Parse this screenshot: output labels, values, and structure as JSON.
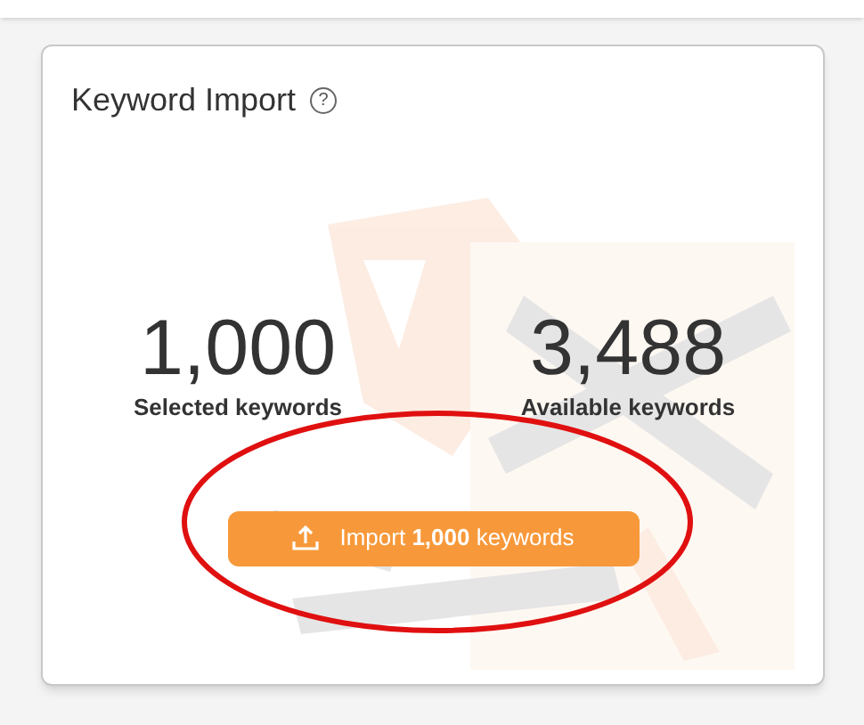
{
  "card": {
    "title": "Keyword Import",
    "help": "?"
  },
  "stats": [
    {
      "value": "1,000",
      "label": "Selected keywords"
    },
    {
      "value": "3,488",
      "label": "Available keywords"
    }
  ],
  "button": {
    "label": "Import **1,000** keywords"
  }
}
